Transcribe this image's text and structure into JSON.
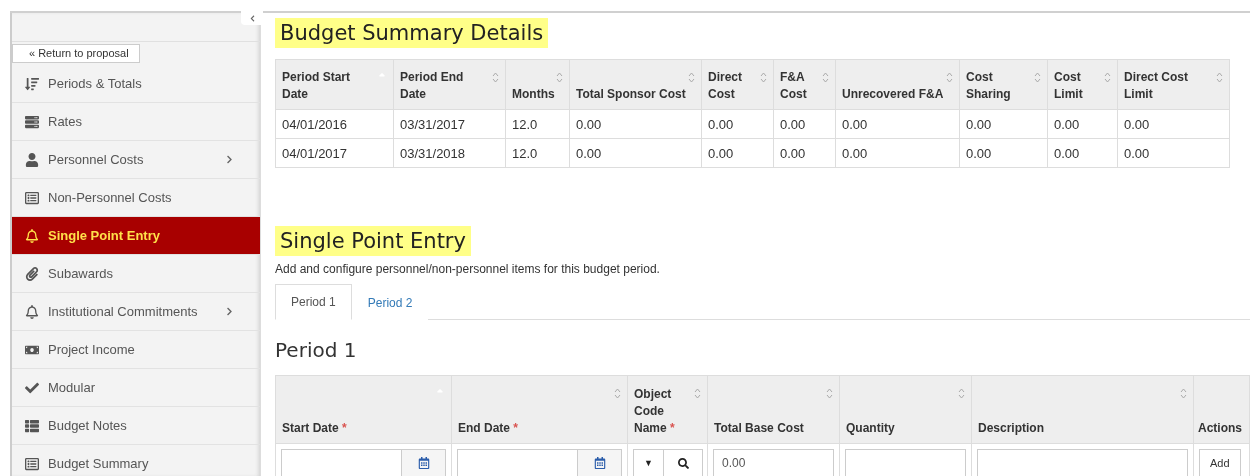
{
  "sidebar": {
    "return_link": "« Return to proposal",
    "items": [
      {
        "label": "Periods & Totals",
        "selected": false,
        "expandable": false
      },
      {
        "label": "Rates",
        "selected": false,
        "expandable": false
      },
      {
        "label": "Personnel Costs",
        "selected": false,
        "expandable": true
      },
      {
        "label": "Non-Personnel Costs",
        "selected": false,
        "expandable": false
      },
      {
        "label": "Single Point Entry",
        "selected": true,
        "expandable": false
      },
      {
        "label": "Subawards",
        "selected": false,
        "expandable": false
      },
      {
        "label": "Institutional Commitments",
        "selected": false,
        "expandable": true
      },
      {
        "label": "Project Income",
        "selected": false,
        "expandable": false
      },
      {
        "label": "Modular",
        "selected": false,
        "expandable": false
      },
      {
        "label": "Budget Notes",
        "selected": false,
        "expandable": false
      },
      {
        "label": "Budget Summary",
        "selected": false,
        "expandable": false
      }
    ]
  },
  "summary": {
    "title": "Budget Summary Details",
    "table": {
      "columns": [
        {
          "label": "Period Start Date",
          "sorted": true
        },
        {
          "label": "Period End Date",
          "sorted": false
        },
        {
          "label": "Months",
          "sorted": false
        },
        {
          "label": "Total Sponsor Cost",
          "sorted": false
        },
        {
          "label": "Direct Cost",
          "sorted": false
        },
        {
          "label": "F&A Cost",
          "sorted": false
        },
        {
          "label": "Unrecovered F&A",
          "sorted": false
        },
        {
          "label": "Cost Sharing",
          "sorted": false
        },
        {
          "label": "Cost Limit",
          "sorted": false
        },
        {
          "label": "Direct Cost Limit",
          "sorted": false
        }
      ],
      "rows": [
        [
          "04/01/2016",
          "03/31/2017",
          "12.0",
          "0.00",
          "0.00",
          "0.00",
          "0.00",
          "0.00",
          "0.00",
          "0.00"
        ],
        [
          "04/01/2017",
          "03/31/2018",
          "12.0",
          "0.00",
          "0.00",
          "0.00",
          "0.00",
          "0.00",
          "0.00",
          "0.00"
        ]
      ]
    }
  },
  "single_point_entry": {
    "title": "Single Point Entry",
    "description": "Add and configure personnel/non-personnel items for this budget period.",
    "tabs": [
      {
        "label": "Period 1",
        "selected": true
      },
      {
        "label": "Period 2",
        "selected": false
      }
    ],
    "period_heading": "Period 1",
    "table": {
      "columns": [
        {
          "label": "Start Date",
          "sorted": true,
          "required_mark": "*"
        },
        {
          "label": "End Date",
          "sorted": false,
          "required_mark": "*"
        },
        {
          "label": "Object Code Name",
          "sorted": false,
          "required_mark": "*"
        },
        {
          "label": "Total Base Cost",
          "sorted": false
        },
        {
          "label": "Quantity",
          "sorted": false
        },
        {
          "label": "Description",
          "sorted": false
        },
        {
          "label": "Actions"
        }
      ],
      "entry_row": [
        {
          "kind": "date"
        },
        {
          "kind": "date"
        },
        {
          "kind": "lookup",
          "dropdown_glyph": "▼"
        },
        {
          "kind": "text",
          "value": "0.00"
        },
        {
          "kind": "text"
        },
        {
          "kind": "text"
        },
        {
          "kind": "button",
          "label": "Add"
        }
      ]
    }
  }
}
